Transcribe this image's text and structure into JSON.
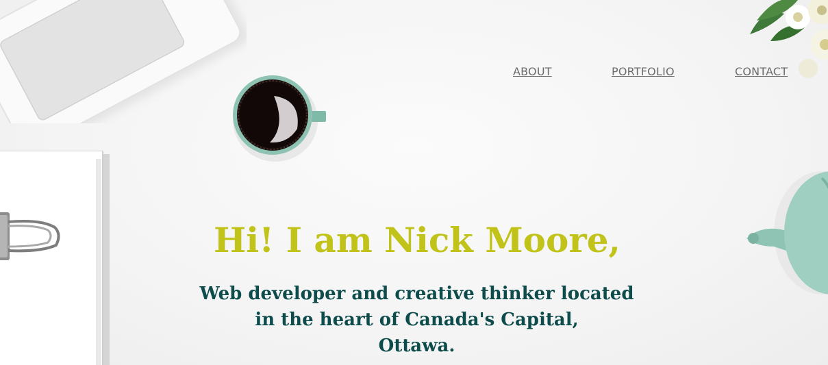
{
  "nav": {
    "about": "ABOUT",
    "portfolio": "PORTFOLIO",
    "contact": "CONTACT"
  },
  "hero": {
    "title": "Hi! I am Nick Moore,",
    "subtitle_lines": [
      "Web developer and creative thinker located",
      "in the heart of Canada's Capital,",
      "Ottawa."
    ]
  },
  "colors": {
    "title": "#c1c31a",
    "subtitle": "#0e4b4b",
    "nav": "#6b6b6b",
    "background": "#f7f7f7"
  },
  "icons": {
    "laptop": "laptop-image",
    "notebook": "notebook-with-binder-clip-image",
    "coffee": "coffee-cup-image",
    "flowers": "flowers-image",
    "teapot": "teapot-image"
  }
}
